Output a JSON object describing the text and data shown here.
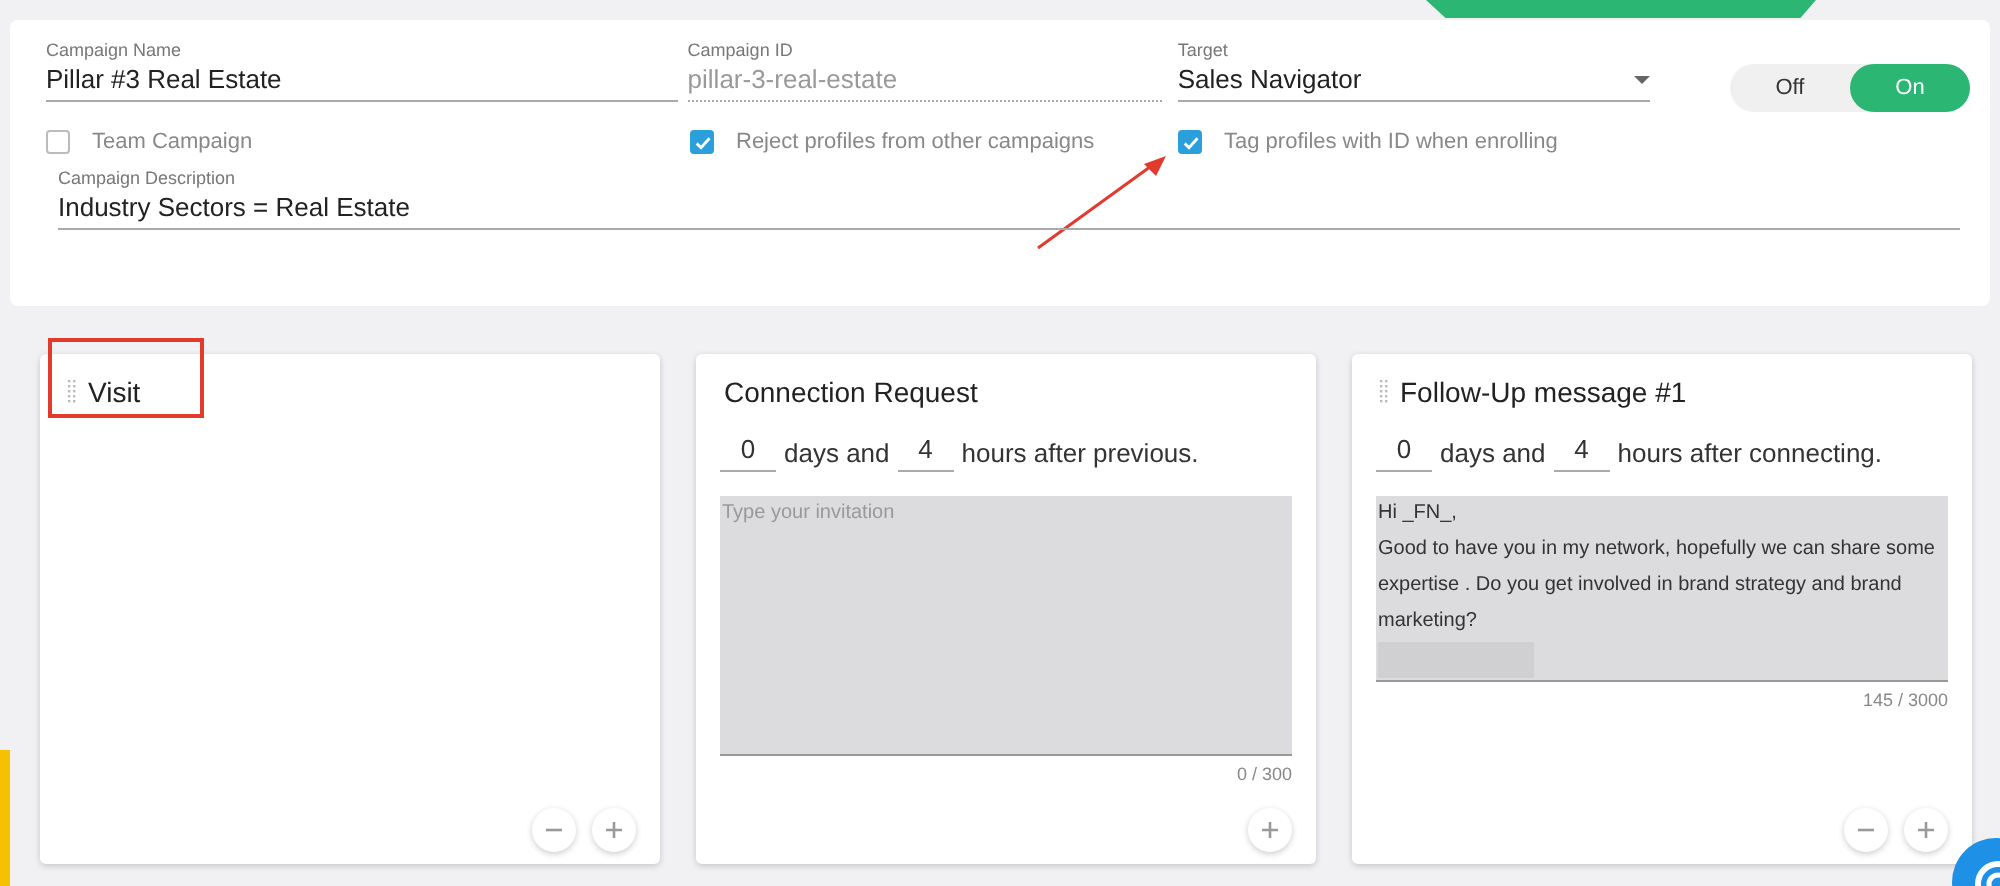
{
  "campaign": {
    "name": {
      "label": "Campaign Name",
      "value": "Pillar #3 Real Estate"
    },
    "id": {
      "label": "Campaign ID",
      "value": "pillar-3-real-estate",
      "disabled": true
    },
    "target": {
      "label": "Target",
      "value": "Sales Navigator"
    },
    "status": [
      {
        "label": "Off",
        "selected": false
      },
      {
        "label": "On",
        "selected": true
      }
    ],
    "options": [
      {
        "label": "Team Campaign",
        "checked": false,
        "annotated": false
      },
      {
        "label": "Reject profiles from other campaigns",
        "checked": true,
        "annotated": false
      },
      {
        "label": "Tag profiles with ID when enrolling",
        "checked": true,
        "annotated": true
      }
    ],
    "description": {
      "label": "Campaign Description",
      "value": "Industry Sectors = Real Estate"
    }
  },
  "steps": [
    {
      "title": "Visit",
      "draggable": true,
      "highlighted": true,
      "removable": true
    },
    {
      "title": "Connection Request",
      "draggable": false,
      "highlighted": false,
      "removable": false,
      "days": "0",
      "days_label": "days and",
      "hours": "4",
      "hours_label": "hours after previous.",
      "message": {
        "placeholder": "Type your invitation",
        "redacted": false
      },
      "counter": "0 / 300"
    },
    {
      "title": "Follow-Up message #1",
      "draggable": true,
      "highlighted": false,
      "removable": true,
      "days": "0",
      "days_label": "days and",
      "hours": "4",
      "hours_label": "hours after connecting.",
      "message": {
        "value": "Hi _FN_,\nGood to have you in my network, hopefully we can share some expertise . Do you get involved in brand strategy and brand marketing?",
        "redacted": true
      },
      "counter": "145 / 3000"
    }
  ]
}
